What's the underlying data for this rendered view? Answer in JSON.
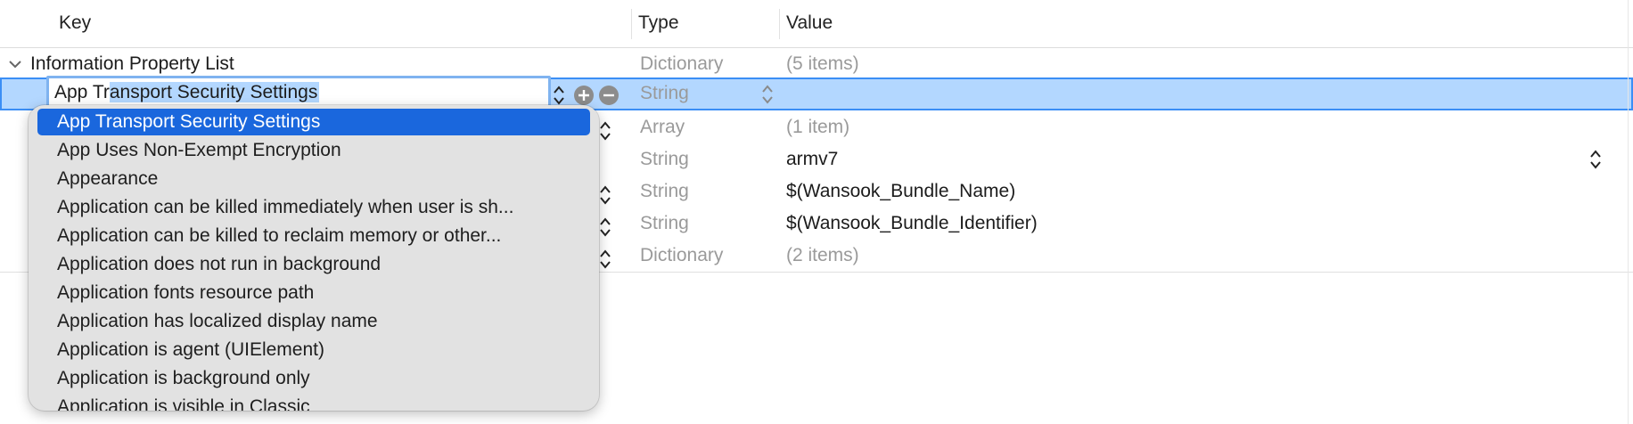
{
  "header": {
    "key": "Key",
    "type": "Type",
    "value": "Value"
  },
  "rows": [
    {
      "key": "Information Property List",
      "type": "Dictionary",
      "value": "(5 items)"
    },
    {
      "key": "App Transport Security Settings",
      "type": "String",
      "value": ""
    },
    {
      "key": "",
      "type": "Array",
      "value": "(1 item)"
    },
    {
      "key": "",
      "type": "String",
      "value": "armv7"
    },
    {
      "key": "",
      "type": "String",
      "value": "$(Wansook_Bundle_Name)"
    },
    {
      "key": "",
      "type": "String",
      "value": "$(Wansook_Bundle_Identifier)"
    },
    {
      "key": "",
      "type": "Dictionary",
      "value": "(2 items)"
    }
  ],
  "edit_field": {
    "prefix": "App Tr",
    "selected": "ansport Security Settings"
  },
  "popup": {
    "items": [
      "App Transport Security Settings",
      "App Uses Non-Exempt Encryption",
      "Appearance",
      "Application can be killed immediately when user is sh...",
      "Application can be killed to reclaim memory or other...",
      "Application does not run in background",
      "Application fonts resource path",
      "Application has localized display name",
      "Application is agent (UIElement)",
      "Application is background only",
      "Application is visible in Classic"
    ],
    "active_index": 0
  },
  "colors": {
    "selection": "#b3d7ff",
    "selection_border": "#3b8ef5",
    "popup_active": "#1a67dd",
    "popup_bg": "#e2e2e2"
  },
  "icons": [
    "chevron-down-icon",
    "stepper-icon",
    "add-icon",
    "remove-icon"
  ]
}
